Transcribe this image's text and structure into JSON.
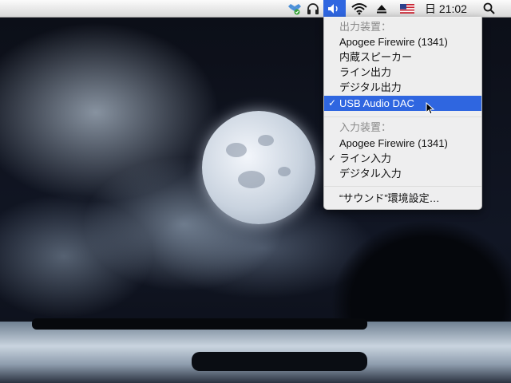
{
  "menubar": {
    "clock": "日 21:02"
  },
  "sound_menu": {
    "output_header": "出力装置：",
    "output_items": [
      {
        "label": "Apogee Firewire (1341)",
        "checked": false,
        "selected": false
      },
      {
        "label": "内蔵スピーカー",
        "checked": false,
        "selected": false
      },
      {
        "label": "ライン出力",
        "checked": false,
        "selected": false
      },
      {
        "label": "デジタル出力",
        "checked": false,
        "selected": false
      },
      {
        "label": "USB Audio DAC",
        "checked": true,
        "selected": true
      }
    ],
    "input_header": "入力装置：",
    "input_items": [
      {
        "label": "Apogee Firewire (1341)",
        "checked": false
      },
      {
        "label": "ライン入力",
        "checked": true
      },
      {
        "label": "デジタル入力",
        "checked": false
      }
    ],
    "preferences": "“サウンド”環境設定…",
    "checkmark": "✓"
  },
  "colors": {
    "selection": "#2f66e0",
    "menubar_bg": "#e6e6e6"
  },
  "icons": [
    "dropbox-icon",
    "headphones-icon",
    "volume-icon",
    "wifi-icon",
    "eject-icon",
    "us-flag-icon",
    "spotlight-icon"
  ]
}
